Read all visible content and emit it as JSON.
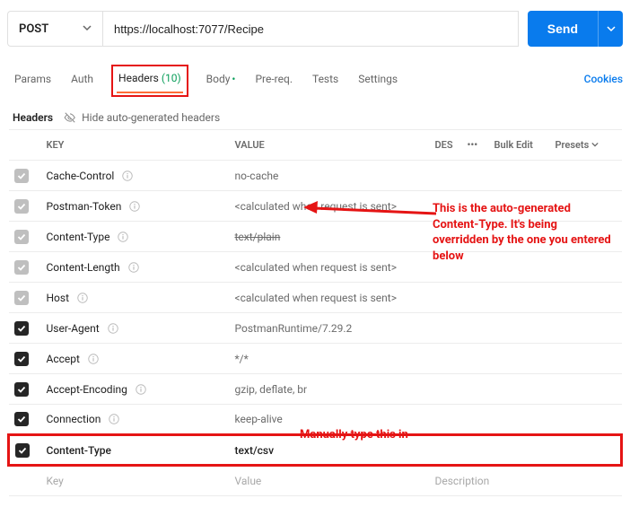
{
  "request": {
    "method": "POST",
    "url": "https://localhost:7077/Recipe",
    "send_label": "Send"
  },
  "tabs": {
    "params": "Params",
    "auth": "Auth",
    "headers": "Headers",
    "headers_count": "(10)",
    "body": "Body",
    "prereq": "Pre-req.",
    "tests": "Tests",
    "settings": "Settings",
    "cookies": "Cookies"
  },
  "subheader": {
    "title": "Headers",
    "hide": "Hide auto-generated headers"
  },
  "columns": {
    "key": "KEY",
    "value": "VALUE",
    "des": "DES",
    "more": "•••",
    "bulk": "Bulk Edit",
    "presets": "Presets"
  },
  "rows": [
    {
      "key": "Cache-Control",
      "value": "no-cache",
      "dim": true,
      "strike": false
    },
    {
      "key": "Postman-Token",
      "value": "<calculated when request is sent>",
      "dim": true,
      "strike": false
    },
    {
      "key": "Content-Type",
      "value": "text/plain",
      "dim": true,
      "strike": true
    },
    {
      "key": "Content-Length",
      "value": "<calculated when request is sent>",
      "dim": true,
      "strike": false
    },
    {
      "key": "Host",
      "value": "<calculated when request is sent>",
      "dim": true,
      "strike": false
    },
    {
      "key": "User-Agent",
      "value": "PostmanRuntime/7.29.2",
      "dim": false,
      "strike": false
    },
    {
      "key": "Accept",
      "value": "*/*",
      "dim": false,
      "strike": false
    },
    {
      "key": "Accept-Encoding",
      "value": "gzip, deflate, br",
      "dim": false,
      "strike": false
    },
    {
      "key": "Connection",
      "value": "keep-alive",
      "dim": false,
      "strike": false
    }
  ],
  "manual_row": {
    "key": "Content-Type",
    "value": "text/csv"
  },
  "add_row": {
    "key": "Key",
    "value": "Value",
    "desc": "Description"
  },
  "annotations": {
    "a1": "This is the auto-generated Content-Type. It's being overridden by the one you entered below",
    "a2": "Manually type this in"
  }
}
